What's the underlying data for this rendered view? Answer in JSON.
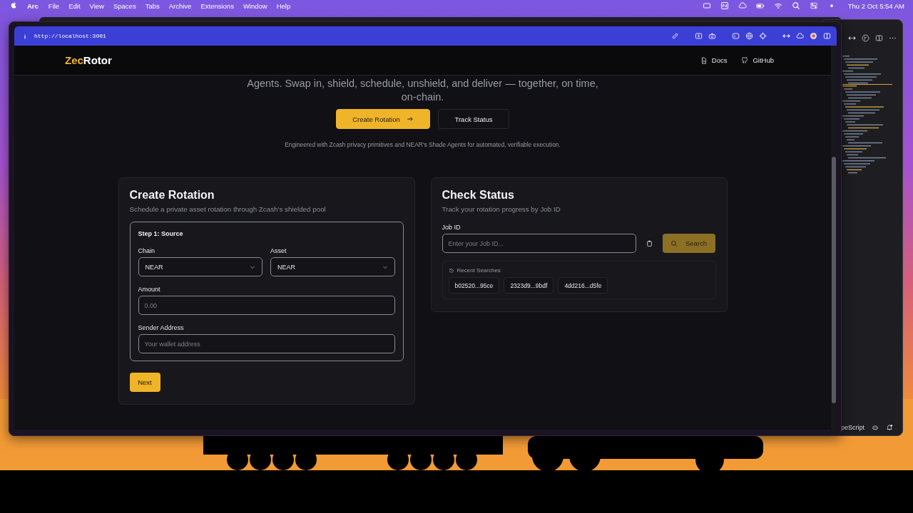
{
  "menubar": {
    "app": "Arc",
    "menus": [
      "File",
      "Edit",
      "View",
      "Spaces",
      "Tabs",
      "Archive",
      "Extensions",
      "Window",
      "Help"
    ],
    "clock": "Thu 2 Oct  5:54 AM"
  },
  "browser": {
    "url": "http://localhost:3001"
  },
  "site": {
    "logo": {
      "accent": "Zec",
      "rest": "Rotor"
    },
    "nav": [
      {
        "label": "Docs",
        "kind": "doc"
      },
      {
        "label": "GitHub",
        "kind": "github"
      }
    ],
    "hero": {
      "text": "Agents. Swap in, shield, schedule, unshield, and deliver — together, on time, on-chain.",
      "buttons": [
        {
          "label": "Create Rotation",
          "kind": "primary"
        },
        {
          "label": "Track Status",
          "kind": "secondary"
        }
      ],
      "tagline": "Engineered with Zcash privacy primitives and NEAR's Shade Agents for automated, verifiable execution."
    },
    "create": {
      "title": "Create Rotation",
      "subtitle": "Schedule a private asset rotation through Zcash's shielded pool",
      "step": "Step 1: Source",
      "selects": [
        {
          "label": "Chain",
          "value": "NEAR"
        },
        {
          "label": "Asset",
          "value": "NEAR"
        }
      ],
      "inputs": [
        {
          "label": "Amount",
          "placeholder": "0.00"
        },
        {
          "label": "Sender Address",
          "placeholder": "Your wallet address"
        }
      ],
      "next": "Next"
    },
    "status": {
      "title": "Check Status",
      "subtitle": "Track your rotation progress by Job ID",
      "job_label": "Job ID",
      "job_placeholder": "Enter your Job ID...",
      "search": {
        "label": "Search",
        "disabled": true
      },
      "recent_title": "Recent Searches",
      "recent": [
        "b02520...95ce",
        "2323d9...9bdf",
        "4dd216...d5fe"
      ]
    }
  },
  "editor": {
    "status_text": "peScript"
  }
}
